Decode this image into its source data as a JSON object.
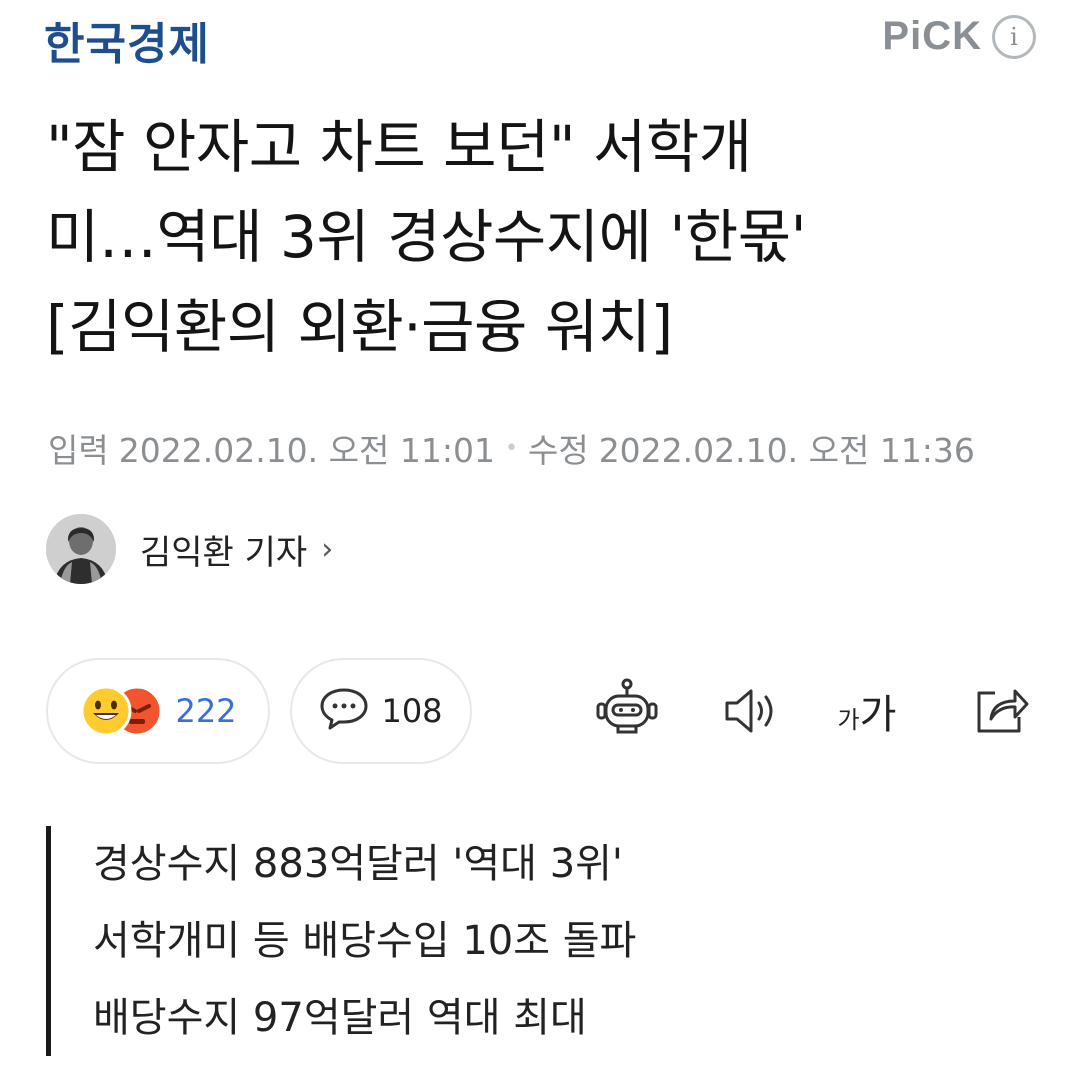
{
  "header": {
    "publisher": "한국경제",
    "pick_label": "PiCK",
    "info_glyph": "i"
  },
  "article": {
    "headline_lines": [
      "\"잠 안자고 차트 보던\" 서학개",
      "미…역대 3위 경상수지에 '한몫'",
      "[김익환의 외환·금융 워치]"
    ],
    "input_label": "입력",
    "input_date": "2022.02.10. 오전 11:01",
    "modified_label": "수정",
    "modified_date": "2022.02.10. 오전 11:36",
    "separator": "•",
    "reporter": "김익환 기자",
    "reporter_chevron": "›"
  },
  "actions": {
    "reaction_count": "222",
    "comment_count": "108",
    "font_size_small": "가",
    "font_size_large": "가",
    "icons": [
      "happy-emoji-icon",
      "angry-emoji-icon",
      "comment-bubble-icon",
      "robot-summary-icon",
      "speaker-icon",
      "font-size-icon",
      "share-icon"
    ]
  },
  "summary": {
    "lines": [
      "경상수지 883억달러 '역대 3위'",
      "서학개미 등 배당수입 10조 돌파",
      "배당수지 97억달러 역대 최대"
    ]
  },
  "colors": {
    "publisher_blue": "#1e4f8c",
    "reaction_blue": "#3b6fd6",
    "meta_gray": "#8b8f94"
  }
}
